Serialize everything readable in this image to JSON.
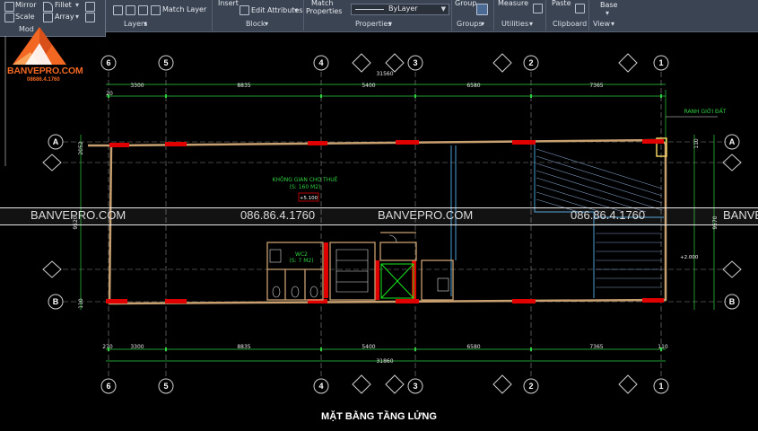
{
  "ribbon": {
    "modify": {
      "mirror": "Mirror",
      "fillet": "Fillet",
      "scale": "Scale",
      "array": "Array",
      "title_partial": "Mod"
    },
    "layers": {
      "match_layer": "Match Layer",
      "title": "Layers"
    },
    "block": {
      "insert": "Insert",
      "edit_attributes": "Edit Attributes",
      "title": "Block"
    },
    "properties": {
      "match_line1": "Match",
      "match_line2": "Properties",
      "bylayer": "ByLayer",
      "title": "Properties"
    },
    "groups": {
      "group": "Group",
      "title": "Groups"
    },
    "utilities": {
      "measure": "Measure",
      "title": "Utilities"
    },
    "clipboard": {
      "paste": "Paste",
      "title": "Clipboard"
    },
    "view": {
      "base": "Base",
      "title": "View"
    }
  },
  "logo": {
    "name": "BANVEPRO.COM",
    "phone": "08686.4.1760"
  },
  "drawing": {
    "top_axes": [
      "6",
      "5",
      "4",
      "3",
      "2",
      "1"
    ],
    "bottom_axes": [
      "6",
      "5",
      "4",
      "3",
      "2",
      "1"
    ],
    "side_axes": [
      "A",
      "B"
    ],
    "top_dims": [
      "3300",
      "8835",
      "5400",
      "6580",
      "7365"
    ],
    "bottom_dims": [
      "3300",
      "8835",
      "5400",
      "6580",
      "7365"
    ],
    "total_dim": "31560",
    "total_dim_bottom": "31860",
    "edge_dim_left": "270",
    "edge_dim_right": "110",
    "edge_dim_top_left": "20",
    "side_dim_top": "2052",
    "side_dim_mid": "9520",
    "side_dim_right": "9570",
    "side_dim_small": "110",
    "room_label_1": "KHÔNG GIAN CHO THUÊ",
    "room_label_2": "(S: 160 M2)",
    "room_level": "+5.100",
    "boundary_label": "RANH GIỚI ĐẤT",
    "wc_label_1": "WC2",
    "wc_label_2": "(S: 7 M2)",
    "level_right": "+2.000"
  },
  "watermark": {
    "site": "BANVEPRO.COM",
    "phone": "086.86.4.1760",
    "site_cut": "BANVE"
  },
  "plan_title": "MẶT BẰNG TẦNG LỬNG",
  "colors": {
    "wall": "#c8a070",
    "red_column": "#e00000",
    "dim": "#2fd040",
    "grid": "#bbbbbb",
    "cyan_line": "#4aa0d8",
    "logo_orange": "#f26722"
  }
}
